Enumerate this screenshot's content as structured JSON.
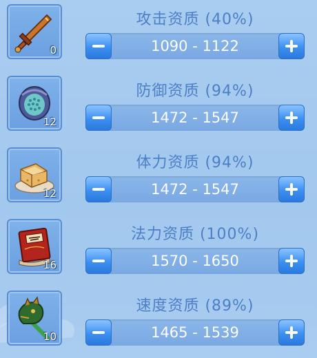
{
  "attributes": [
    {
      "name": "攻击资质 (40%)",
      "range": "1090 - 1122",
      "count": "0",
      "icon": "sword-icon"
    },
    {
      "name": "防御资质 (94%)",
      "range": "1472 - 1547",
      "count": "12",
      "icon": "armor-icon"
    },
    {
      "name": "体力资质 (94%)",
      "range": "1472 - 1547",
      "count": "12",
      "icon": "food-plate-icon"
    },
    {
      "name": "法力资质 (100%)",
      "range": "1570 - 1650",
      "count": "16",
      "icon": "spellbook-icon"
    },
    {
      "name": "速度资质 (89%)",
      "range": "1465 - 1539",
      "count": "10",
      "icon": "horse-staff-icon"
    }
  ],
  "colors": {
    "title": "#4d7fc6",
    "button": "#3d8ff2",
    "bar": "#7aa8e2"
  }
}
